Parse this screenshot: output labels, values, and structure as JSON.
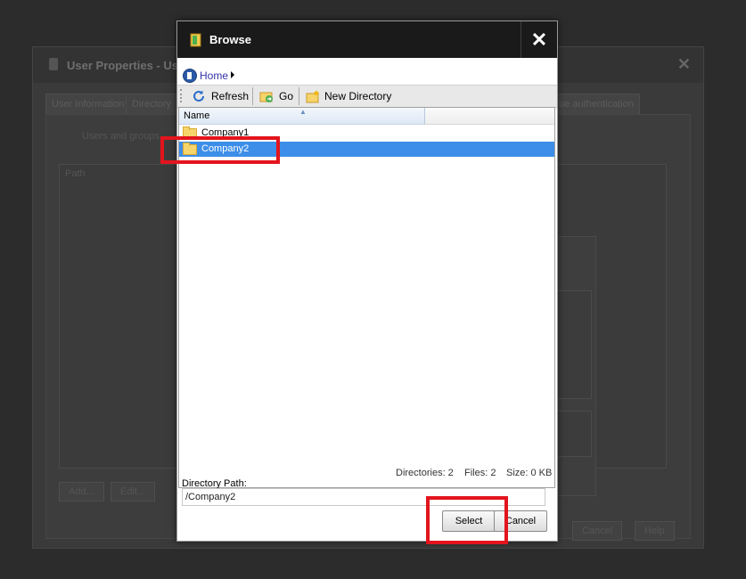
{
  "background": {
    "window_title": "User Properties - Use",
    "tabs": [
      "User Information",
      "Directory",
      "...ue authentication"
    ],
    "panel_text": "Users and groups...",
    "list_header": "Path",
    "buttons": [
      "Add...",
      "Edit...",
      "Cancel",
      "Help"
    ]
  },
  "dialog": {
    "title": "Browse",
    "close_glyph": "✕"
  },
  "breadcrumb": {
    "home_label": "Home"
  },
  "toolbar": {
    "refresh_label": "Refresh",
    "go_label": "Go",
    "new_directory_label": "New Directory"
  },
  "file_list": {
    "column_name": "Name",
    "items": [
      {
        "name": "Company1",
        "icon": "folder-icon",
        "selected": false
      },
      {
        "name": "Company2",
        "icon": "folder-icon",
        "selected": true
      }
    ]
  },
  "status": {
    "directories": "Directories: 2",
    "files": "Files: 2",
    "size": "Size: 0 KB"
  },
  "directory_path": {
    "label": "Directory Path:",
    "value": "/Company2"
  },
  "buttons": {
    "select_label": "Select",
    "cancel_label": "Cancel"
  },
  "colors": {
    "titlebar": "#1a1a1a",
    "selection": "#3d8ee8",
    "highlight_box": "#e3141d"
  }
}
